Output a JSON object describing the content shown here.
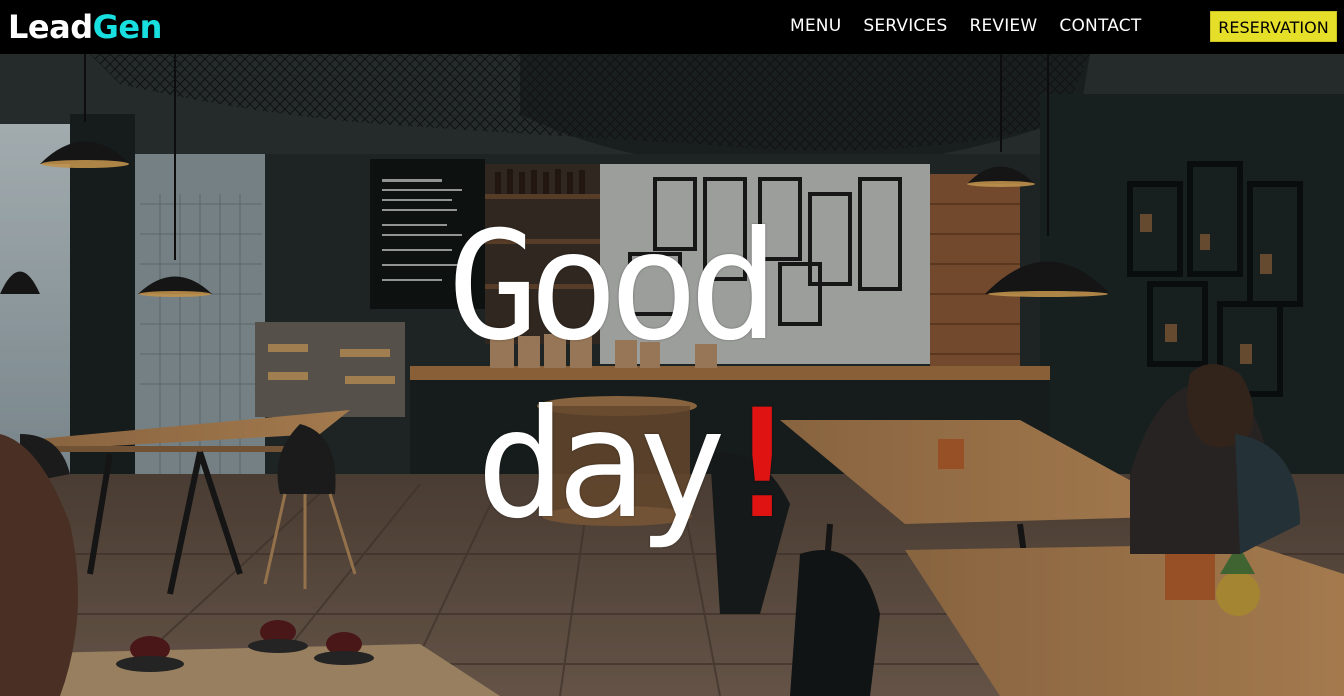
{
  "brand": {
    "lead": "Lead",
    "gen": "Gen",
    "accent_color": "#19e0e0"
  },
  "nav": {
    "items": [
      {
        "label": "MENU"
      },
      {
        "label": "SERVICES"
      },
      {
        "label": "REVIEW"
      },
      {
        "label": "CONTACT"
      }
    ],
    "reservation_label": "RESERVATION",
    "reservation_color": "#e6df2a"
  },
  "hero": {
    "headline_line1": "Good",
    "headline_line2": "day",
    "exclamation": "!",
    "exclamation_color": "#e01313",
    "background_description_icon": "cafe-interior-photo"
  }
}
